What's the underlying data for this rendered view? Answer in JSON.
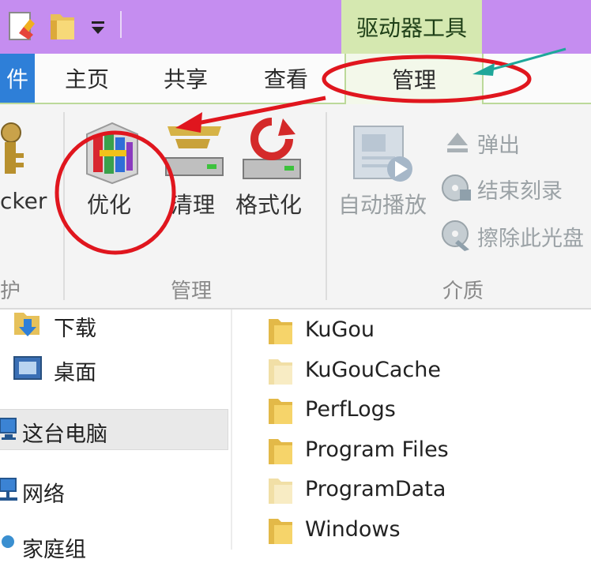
{
  "title_bar": {
    "drive_tools_label": "驱动器工具"
  },
  "ribbon_tabs": {
    "file_label": "件",
    "home": "主页",
    "share": "共享",
    "view": "查看",
    "manage": "管理"
  },
  "ribbon": {
    "bitlocker_label": "cker",
    "protect_group_label": "护",
    "optimize": "优化",
    "cleanup": "清理",
    "format": "格式化",
    "manage_group_label": "管理",
    "autoplay": "自动播放",
    "eject": "弹出",
    "finish_burning": "结束刻录",
    "erase_disc": "擦除此光盘",
    "media_group_label": "介质"
  },
  "nav_pane": {
    "downloads": "下载",
    "desktop": "桌面",
    "this_pc": "这台电脑",
    "network": "网络",
    "homegroup": "家庭组"
  },
  "files": [
    {
      "name": "KuGou",
      "faded": false
    },
    {
      "name": "KuGouCache",
      "faded": true
    },
    {
      "name": "PerfLogs",
      "faded": false
    },
    {
      "name": "Program Files",
      "faded": false
    },
    {
      "name": "ProgramData",
      "faded": true
    },
    {
      "name": "Windows",
      "faded": false
    }
  ],
  "colors": {
    "title_bar": "#c58df0",
    "drive_tools_tab": "#d5e8b0",
    "file_tab": "#2e7fd8",
    "annotation_red": "#e0161e",
    "annotation_teal": "#1fa79a"
  }
}
